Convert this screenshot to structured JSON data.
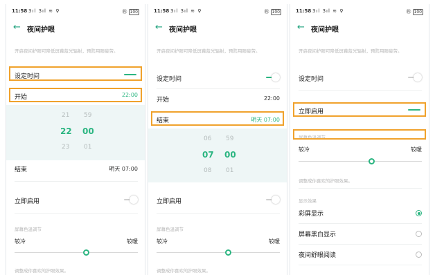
{
  "status": {
    "time": "11:58",
    "signal": "3ıl 3ıl ≋ ⚲",
    "right_icons": "Ⓝ",
    "battery": "100"
  },
  "title": "夜间护眼",
  "hint": "开启夜间护眼可降低屏幕蓝光辐射，预防用眼疲劳。",
  "panel1": {
    "set_time": "设定时间",
    "start": "开始",
    "start_value": "22:00",
    "picker_hours": [
      "21",
      "22",
      "23"
    ],
    "picker_minutes": [
      "59",
      "00",
      "01"
    ],
    "end": "结束",
    "end_value": "明天 07:00",
    "enable_now": "立即启用",
    "color_section": "屏幕色温调节",
    "cooler": "较冷",
    "warmer": "较暖",
    "adjust_hint": "调整成你喜欢的护眼效果。"
  },
  "panel2": {
    "set_time": "设定时间",
    "start": "开始",
    "start_value": "22:00",
    "end": "结束",
    "end_value": "明天 07:00",
    "picker_hours": [
      "06",
      "07",
      "08"
    ],
    "picker_minutes": [
      "59",
      "00",
      "01"
    ],
    "enable_now": "立即启用",
    "color_section": "屏幕色温调节",
    "cooler": "较冷",
    "warmer": "较暖",
    "adjust_hint": "调整成你喜欢的护眼效果。"
  },
  "panel3": {
    "set_time": "设定时间",
    "enable_now": "立即启用",
    "color_section": "屏幕色温调节",
    "cooler": "较冷",
    "warmer": "较暖",
    "adjust_hint": "调整成你喜欢的护眼效果。",
    "display_section": "显示效果",
    "options": [
      "彩屏显示",
      "屏幕黑白显示",
      "夜间舒眼阅读"
    ],
    "selected_option": "彩屏显示"
  },
  "colors": {
    "accent": "#2bb581",
    "highlight": "#f0a22c"
  }
}
